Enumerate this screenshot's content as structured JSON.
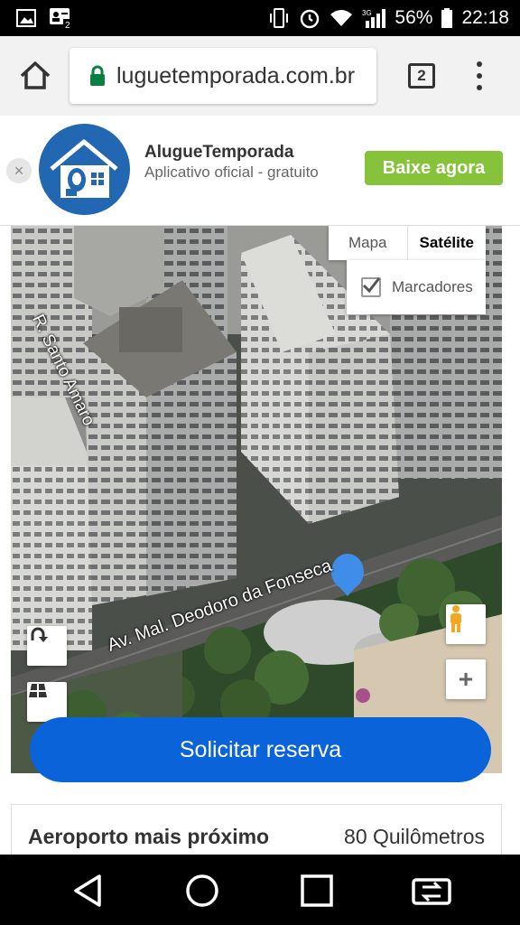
{
  "status_bar": {
    "icons_left": [
      "image-icon",
      "contact-card-icon"
    ],
    "battery": "56%",
    "time": "22:18",
    "signal_label": "3G"
  },
  "browser": {
    "url": "luguetemporada.com.br",
    "tab_count": "2"
  },
  "app_banner": {
    "close": "×",
    "app_name": "AlugueTemporada",
    "app_subtitle": "Aplicativo oficial - gratuito",
    "install_label": "Baixe agora",
    "install_color": "#86c33a",
    "brand_color": "#2167b1"
  },
  "map": {
    "type_map": "Mapa",
    "type_satellite": "Satélite",
    "markers_label": "Marcadores",
    "markers_checked": true,
    "streets": [
      "R. Santo Amaro",
      "Av. Mal. Deodoro da Fonseca"
    ],
    "zoom_in": "+",
    "pin_color": "#3f8de8"
  },
  "cta": {
    "label": "Solicitar reserva",
    "color": "#0a63d8"
  },
  "info": {
    "label": "Aeroporto mais próximo",
    "value": "80 Quilômetros"
  }
}
